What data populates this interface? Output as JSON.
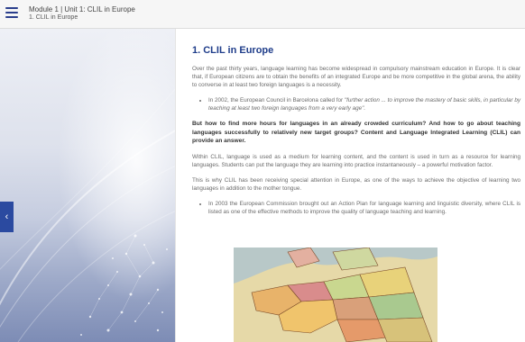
{
  "header": {
    "title": "Module 1 | Unit 1: CLIL in Europe",
    "subtitle": "1. CLIL in Europe"
  },
  "nav": {
    "back_glyph": "‹"
  },
  "icons": {
    "menu": "hamburger-menu-icon",
    "back": "chevron-left-icon"
  },
  "colors": {
    "accent": "#1f3d8a",
    "nav_tab": "#2b4aa0"
  },
  "content": {
    "heading": "1. CLIL in Europe",
    "para1": "Over the past thirty years, language learning has become widespread in compulsory mainstream education in Europe. It is clear that, if European citizens are to obtain the benefits of an integrated Europe and be more competitive in the global arena, the ability to converse in at least two foreign languages is a necessity.",
    "bullet1_prefix": "In 2002, the European Council in Barcelona called for ",
    "bullet1_quote": "\"further action ... to improve the mastery of basic skills, in particular by teaching at least two foreign languages from a very early age\".",
    "question": "But how to find more hours for languages in an already crowded curriculum? And how to go about teaching languages successfully to relatively new target groups? Content and Language Integrated Learning (CLIL) can provide an answer.",
    "para2": "Within CLIL, language is used as a medium for learning content, and the content is used in turn as a resource for learning languages. Students can put the language they are learning into practice instantaneously – a powerful motivation factor.",
    "para3": "This is why CLIL has been receiving special attention in Europe, as one of the ways to achieve the objective of learning two languages in addition to the mother tongue.",
    "bullet2": "In 2003 the European Commission brought out an Action Plan for language learning and linguistic diversity, where CLIL is listed as one of the effective methods to improve the quality of language teaching and learning."
  }
}
